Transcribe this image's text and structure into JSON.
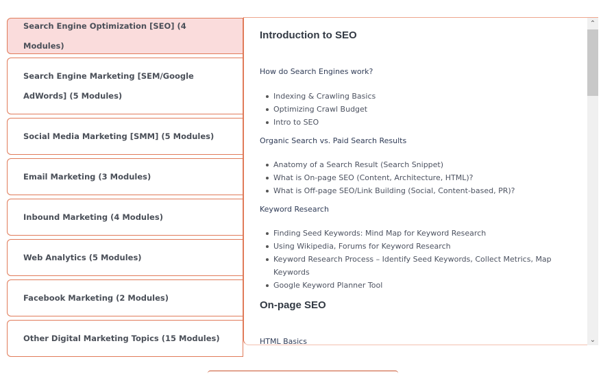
{
  "tabs": [
    {
      "label": "Search Engine Optimization [SEO] (4 Modules)",
      "active": true
    },
    {
      "label": "Search Engine Marketing [SEM/Google AdWords] (5 Modules)",
      "active": false
    },
    {
      "label": "Social Media Marketing [SMM] (5 Modules)",
      "active": false
    },
    {
      "label": "Email Marketing (3 Modules)",
      "active": false
    },
    {
      "label": "Inbound Marketing (4 Modules)",
      "active": false
    },
    {
      "label": "Web Analytics (5 Modules)",
      "active": false
    },
    {
      "label": "Facebook Marketing (2 Modules)",
      "active": false
    },
    {
      "label": "Other Digital Marketing Topics (15 Modules)",
      "active": false
    }
  ],
  "content": {
    "module1_title": "Introduction to SEO",
    "sections": [
      {
        "title": "How do Search Engines work?",
        "items": [
          " Indexing & Crawling Basics",
          "Optimizing Crawl Budget",
          "Intro to SEO"
        ]
      },
      {
        "title": "Organic Search vs. Paid Search Results",
        "items": [
          "Anatomy of a Search Result (Search Snippet)",
          "What is On-page SEO (Content, Architecture, HTML)?",
          "What is Off-page SEO/Link Building (Social, Content-based, PR)?"
        ]
      },
      {
        "title": "Keyword Research",
        "items": [
          "Finding Seed Keywords: Mind Map for Keyword Research",
          "Using Wikipedia, Forums for Keyword Research",
          "Keyword Research Process – Identify Seed Keywords, Collect Metrics, Map Keywords",
          "Google Keyword Planner Tool"
        ]
      }
    ],
    "module2_title": "On-page SEO",
    "module2_first_section": "HTML Basics"
  },
  "scrollbar": {
    "up_icon": "⌃",
    "down_icon": "⌄"
  },
  "theme": {
    "accent": "#e07a58",
    "active_bg": "#fadcdc"
  }
}
